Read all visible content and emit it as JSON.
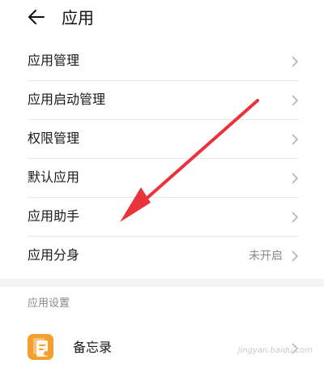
{
  "header": {
    "title": "应用",
    "back_icon": "arrow-left-icon"
  },
  "list": [
    {
      "label": "应用管理",
      "value": ""
    },
    {
      "label": "应用启动管理",
      "value": ""
    },
    {
      "label": "权限管理",
      "value": ""
    },
    {
      "label": "默认应用",
      "value": ""
    },
    {
      "label": "应用助手",
      "value": ""
    },
    {
      "label": "应用分身",
      "value": "未开启"
    }
  ],
  "section": {
    "title": "应用设置"
  },
  "app_item": {
    "label": "备忘录",
    "icon": "notes-app-icon",
    "icon_color": "#f4a030"
  },
  "annotation": {
    "color": "#e8343a"
  },
  "watermark": {
    "text": "jingyan.baidu.com"
  }
}
